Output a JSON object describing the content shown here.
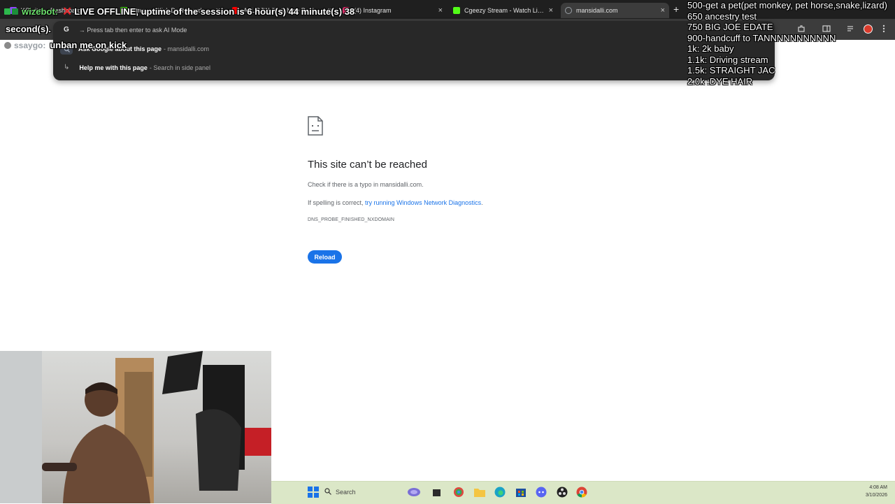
{
  "browser": {
    "tabs": [
      {
        "title": "WTwitch - Dashboard",
        "favicon_color": "#9146ff",
        "active": false
      },
      {
        "title": "Stream - Kick Dashboard",
        "favicon_color": "#53fc18",
        "active": false
      },
      {
        "title": "ALL BJW Jin & Nice Poid - Yo",
        "favicon_color": "#ff0000",
        "active": false
      },
      {
        "title": "(4) Instagram",
        "favicon_color": "#e1306c",
        "active": false
      },
      {
        "title": "Cgeezy Stream - Watch Live on",
        "favicon_color": "#53fc18",
        "active": false
      },
      {
        "title": "mansidalli.com",
        "favicon_color": "#9aa0a6",
        "active": true
      }
    ],
    "close_glyph": "×",
    "new_tab_glyph": "+"
  },
  "omnibox": {
    "hint_icon": "G",
    "hint_text": "→ Press tab then enter to ask AI Mode",
    "suggestions": [
      {
        "strong": "Ask Google about this page",
        "muted": " - mansidalli.com",
        "icon": "lens-icon"
      },
      {
        "strong": "Help me with this page",
        "muted": " - Search in side panel",
        "icon": "return-arrow-icon"
      }
    ]
  },
  "overlay": {
    "bot_name": "wizebot:",
    "status_prefix": "LIVE OFFLINE, uptime of the session is 6 hour(s) 44 minute(s) 38",
    "status_suffix": "second(s).",
    "chat_user": "ssaygo:",
    "chat_message": "unban me on kick",
    "goals": [
      "500-get a pet(pet monkey, pet horse,snake,lizard)",
      "650 ancestry test",
      "750 BIG JOE EDATE",
      "900-handcuff to TANNNNNNNNNNN",
      "1k: 2k baby",
      "1.1k: Driving stream",
      "1.5k: STRAIGHT JAC",
      "2.0k :DYE HAIR"
    ]
  },
  "error_page": {
    "title": "This site can’t be reached",
    "line1": "Check if there is a typo in mansidalli.com.",
    "line2_prefix": "If spelling is correct, ",
    "line2_link": "try running Windows Network Diagnostics",
    "line2_suffix": ".",
    "code": "DNS_PROBE_FINISHED_NXDOMAIN",
    "reload_label": "Reload"
  },
  "taskbar": {
    "search_label": "Search",
    "time": "4:08 AM",
    "date": "3/10/2026",
    "colors": {
      "background": "#dbe7c7",
      "accent": "#1a73e8"
    }
  }
}
